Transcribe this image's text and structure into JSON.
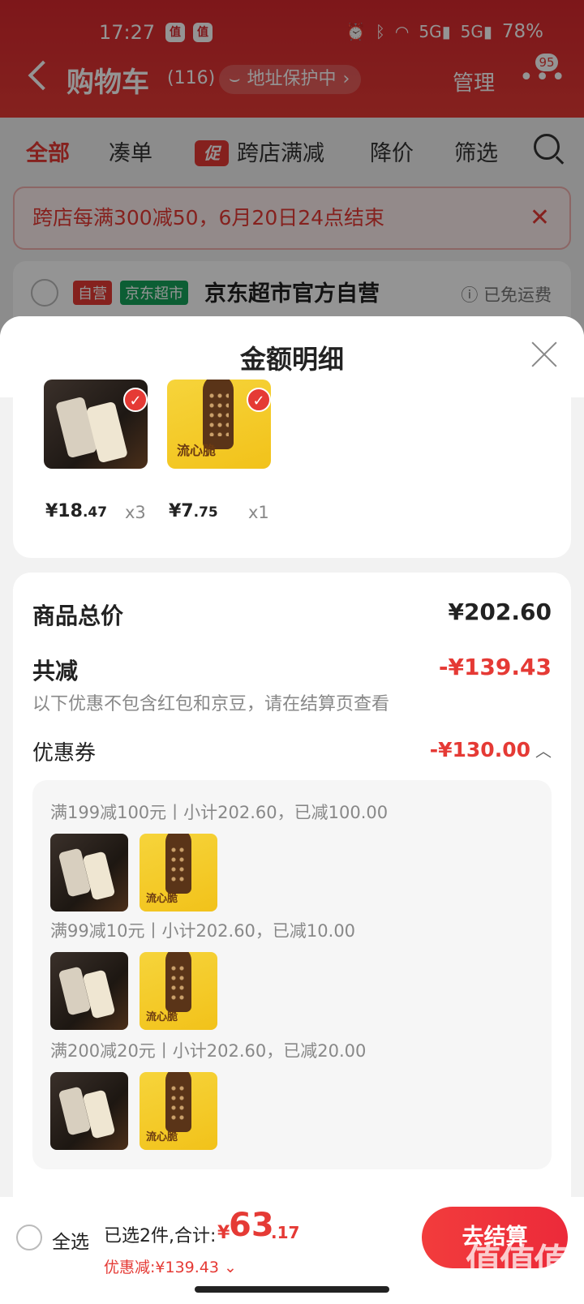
{
  "statusbar": {
    "time": "17:27",
    "app1": "值",
    "app2": "值",
    "battery": "78%",
    "net1": "5G",
    "net2": "5G"
  },
  "nav": {
    "title": "购物车",
    "count": "(116)",
    "address_protect": "地址保护中",
    "manage": "管理",
    "badge": "95"
  },
  "tabs": [
    {
      "label": "全部"
    },
    {
      "label": "凑单"
    },
    {
      "tag": "促",
      "label": "跨店满减"
    },
    {
      "label": "降价"
    },
    {
      "label": "筛选"
    }
  ],
  "banner": {
    "text": "跨店每满300减50，6月20日24点结束"
  },
  "store": {
    "tag_self": "自营",
    "tag_market": "京东超市",
    "name": "京东超市官方自营",
    "shipping": "已免运费"
  },
  "sheet": {
    "title": "金额明细",
    "products": [
      {
        "price_int": "¥18",
        "price_dec": ".47",
        "qty": "x3",
        "thumb": "dark"
      },
      {
        "price_int": "¥7",
        "price_dec": ".75",
        "qty": "x1",
        "thumb": "yellow"
      }
    ],
    "yellow_thumb_text": "流心脆",
    "total_label": "商品总价",
    "total_value": "¥202.60",
    "discount_label": "共减",
    "discount_value": "-¥139.43",
    "discount_note": "以下优惠不包含红包和京豆，请在结算页查看",
    "coupon_label": "优惠券",
    "coupon_value": "-¥130.00",
    "coupon_rules": [
      "满199减100元丨小计202.60，已减100.00",
      "满99减10元丨小计202.60，已减10.00",
      "满200减20元丨小计202.60，已减20.00"
    ]
  },
  "bottom": {
    "select_all": "全选",
    "summary": "已选2件,合计:",
    "currency": "¥",
    "amount_int": "63",
    "amount_dec": ".17",
    "discount": "优惠减:¥139.43",
    "checkout": "去结算"
  },
  "watermark": "值值值",
  "colors": {
    "accent": "#e53a35",
    "header": "#d8282e",
    "market_tag": "#16a35a"
  }
}
